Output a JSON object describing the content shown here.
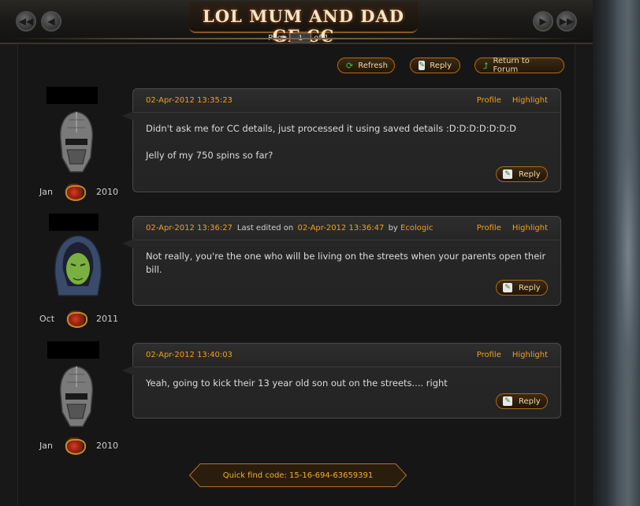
{
  "header": {
    "title": "LOL MUM AND DAD GF CC",
    "page_label": "Page",
    "page_value": "1",
    "page_of": "of 1"
  },
  "toolbar": {
    "refresh_label": "Refresh",
    "reply_label": "Reply",
    "return_label": "Return to Forum"
  },
  "posts": [
    {
      "month": "Jan",
      "year": "2010",
      "date": "02-Apr-2012 13:35:23",
      "profile": "Profile",
      "highlight": "Highlight",
      "body": [
        "Didn't ask me for CC details, just processed it using saved details :D:D:D:D:D:D:D",
        "Jelly of my 750 spins so far?"
      ],
      "reply": "Reply"
    },
    {
      "month": "Oct",
      "year": "2011",
      "date": "02-Apr-2012 13:36:27",
      "edited_prefix": "Last edited on",
      "edited_date": "02-Apr-2012 13:36:47",
      "edited_by": "by",
      "edited_user": "Ecologic",
      "profile": "Profile",
      "highlight": "Highlight",
      "body": [
        "Not really, you're the one who will be living on the streets when your parents open their bill."
      ],
      "reply": "Reply"
    },
    {
      "month": "Jan",
      "year": "2010",
      "date": "02-Apr-2012 13:40:03",
      "profile": "Profile",
      "highlight": "Highlight",
      "body": [
        "Yeah, going to kick their 13 year old son out on the streets.... right"
      ],
      "reply": "Reply"
    }
  ],
  "footer": {
    "quick_find": "Quick find code: 15-16-694-63659391"
  },
  "colors": {
    "accent": "#f0a020",
    "button_border": "#a86a20",
    "background": "#161616"
  }
}
